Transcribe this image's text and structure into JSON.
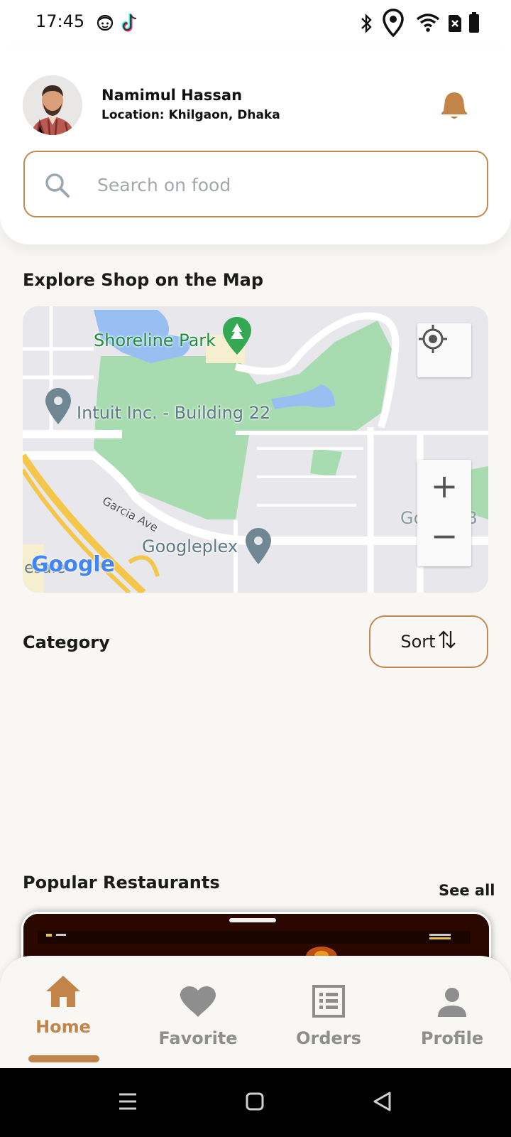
{
  "status_bar": {
    "time": "17:45",
    "left_icons": [
      "face-icon",
      "tiktok-icon"
    ],
    "right_icons": [
      "bluetooth-icon",
      "location-pin-icon",
      "wifi-icon",
      "no-sim-icon",
      "battery-icon"
    ]
  },
  "header": {
    "user_name": "Namimul Hassan",
    "location": "Location: Khilgaon, Dhaka",
    "notification_icon": "bell-icon"
  },
  "search": {
    "placeholder": "Search on food",
    "value": ""
  },
  "map_section": {
    "title": "Explore Shop on the Map",
    "labels": {
      "park": "Shoreline Park",
      "building": "Intuit Inc. - Building 22",
      "street": "Garcia Ave",
      "place": "Googleplex",
      "watermark": "Google",
      "partial_left": "lesale",
      "partial_right": "Google B"
    },
    "controls": {
      "locate": "my-location-icon",
      "zoom_in": "+",
      "zoom_out": "−"
    }
  },
  "category": {
    "title": "Category",
    "sort_label": "Sort",
    "sort_icon": "sort-arrows-icon"
  },
  "popular": {
    "title": "Popular Restaurants",
    "see_all": "See all"
  },
  "bottom_nav": {
    "items": [
      {
        "label": "Home",
        "icon": "home-icon",
        "active": true
      },
      {
        "label": "Favorite",
        "icon": "heart-icon",
        "active": false
      },
      {
        "label": "Orders",
        "icon": "orders-list-icon",
        "active": false
      },
      {
        "label": "Profile",
        "icon": "person-icon",
        "active": false
      }
    ]
  },
  "colors": {
    "accent": "#c3844a",
    "search_border": "#c08a52",
    "background": "#f8f7f4",
    "inactive_nav": "#8e8e8e"
  }
}
